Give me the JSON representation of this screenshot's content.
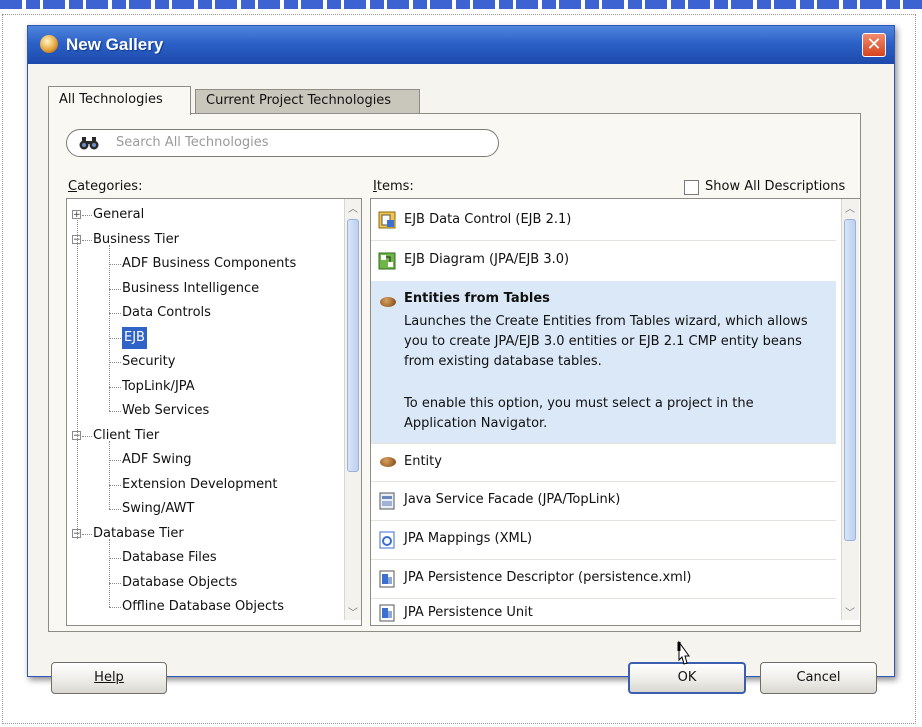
{
  "dialog": {
    "title": "New Gallery",
    "close_glyph": "✕"
  },
  "tabs": [
    {
      "label": "All Technologies",
      "active": true
    },
    {
      "label": "Current Project Technologies",
      "active": false
    }
  ],
  "search": {
    "placeholder": "Search All Technologies",
    "icon": "binoculars-icon"
  },
  "categories": {
    "label": "Categories:",
    "tree": [
      {
        "label": "General",
        "level": 0,
        "expander": "+"
      },
      {
        "label": "Business Tier",
        "level": 0,
        "expander": "−"
      },
      {
        "label": "ADF Business Components",
        "level": 1
      },
      {
        "label": "Business Intelligence",
        "level": 1
      },
      {
        "label": "Data Controls",
        "level": 1
      },
      {
        "label": "EJB",
        "level": 1,
        "selected": true
      },
      {
        "label": "Security",
        "level": 1
      },
      {
        "label": "TopLink/JPA",
        "level": 1
      },
      {
        "label": "Web Services",
        "level": 1
      },
      {
        "label": "Client Tier",
        "level": 0,
        "expander": "−"
      },
      {
        "label": "ADF Swing",
        "level": 1
      },
      {
        "label": "Extension Development",
        "level": 1
      },
      {
        "label": "Swing/AWT",
        "level": 1
      },
      {
        "label": "Database Tier",
        "level": 0,
        "expander": "−"
      },
      {
        "label": "Database Files",
        "level": 1
      },
      {
        "label": "Database Objects",
        "level": 1
      },
      {
        "label": "Offline Database Objects",
        "level": 1
      }
    ]
  },
  "items": {
    "label": "Items:",
    "show_all_descriptions": "Show All Descriptions",
    "show_all_checked": false,
    "list": [
      {
        "name": "EJB Data Control (EJB 2.1)",
        "icon": "data-control-icon"
      },
      {
        "name": "EJB Diagram (JPA/EJB 3.0)",
        "icon": "diagram-icon"
      },
      {
        "name": "Entities from Tables",
        "icon": "bean-icon",
        "selected": true,
        "description": "Launches the Create Entities from Tables wizard, which allows you to create JPA/EJB 3.0 entities or EJB 2.1 CMP entity beans from existing database tables.",
        "note": "To enable this option, you must select a project in the Application Navigator."
      },
      {
        "name": "Entity",
        "icon": "bean-icon"
      },
      {
        "name": "Java Service Facade (JPA/TopLink)",
        "icon": "facade-icon"
      },
      {
        "name": "JPA Mappings (XML)",
        "icon": "mapping-icon"
      },
      {
        "name": "JPA Persistence Descriptor (persistence.xml)",
        "icon": "descriptor-icon"
      },
      {
        "name": "JPA Persistence Unit",
        "icon": "persistence-unit-icon"
      }
    ]
  },
  "buttons": {
    "help": "Help",
    "ok": "OK",
    "cancel": "Cancel"
  },
  "colors": {
    "titlebar": "#2d61c7",
    "selection": "#2f63c8",
    "selected_item_bg": "#dbe8f7"
  }
}
